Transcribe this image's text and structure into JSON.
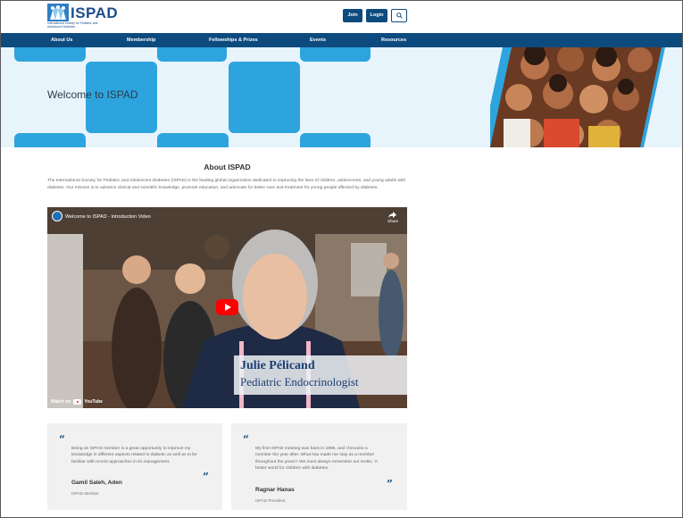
{
  "header": {
    "logo_text": "ISPAD",
    "logo_subtitle": "International Society for Pediatric and Adolescent Diabetes",
    "join_label": "Join",
    "login_label": "Login",
    "search_icon": "search-icon"
  },
  "nav": {
    "items": [
      {
        "label": "About Us"
      },
      {
        "label": "Membership"
      },
      {
        "label": "Fellowships & Prizes"
      },
      {
        "label": "Events"
      },
      {
        "label": "Resources"
      }
    ]
  },
  "hero": {
    "title": "Welcome to ISPAD"
  },
  "about": {
    "title": "About ISPAD",
    "text": "The International Society for Pediatric and Adolescent Diabetes (ISPAD) is the leading global organization dedicated to improving the lives of children, adolescents, and young adults with diabetes. Our mission is to advance clinical and scientific knowledge, promote education, and advocate for better care and treatment for young people affected by diabetes."
  },
  "video": {
    "title": "Welcome to ISPAD - Introduction Video",
    "share_label": "Share",
    "caption_name": "Julie Pélicand",
    "caption_role": "Pediatric Endocrinologist",
    "watch_label": "Watch on",
    "youtube_label": "YouTube"
  },
  "testimonials": [
    {
      "text": "Being an ISPAD member is a great opportunity to improve my knowledge in different aspects related to diabetic as well as to be familiar with recent approaches in its management.",
      "name": "Gamil Saleh, Aden",
      "role": "ISPAD Member"
    },
    {
      "text": "My first ISPAD meeting was back in 1986, and I became a member the year after. What has made me stay as a member throughout the years? We must always remember our motto: 'A better world for children with diabetes.",
      "name": "Ragnar Hanas",
      "role": "ISPAD President"
    }
  ],
  "colors": {
    "brand_navy": "#0d4a7e",
    "tile_blue": "#2ea4de",
    "hero_bg": "#e8f4fc"
  }
}
